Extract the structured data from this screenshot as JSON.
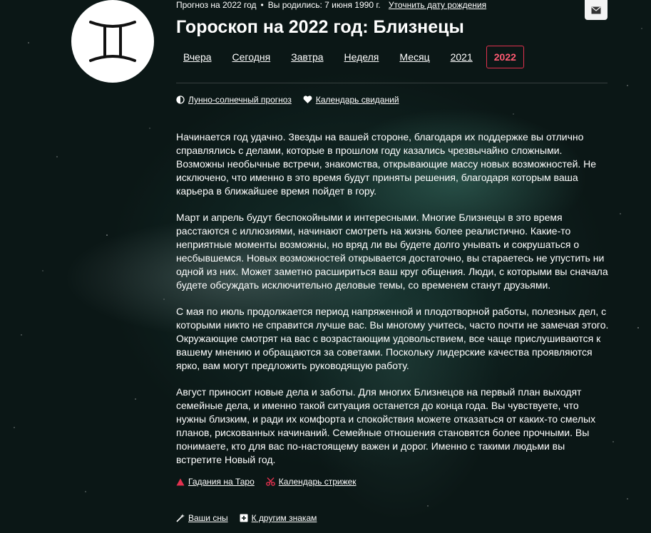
{
  "header": {
    "forecast_year_text": "Прогноз на 2022 год",
    "birth_text": "Вы родились: 7 июня 1990 г.",
    "change_birth_link": "Уточнить дату рождения",
    "title": "Гороскоп на 2022 год: Близнецы"
  },
  "tabs": [
    {
      "label": "Вчера",
      "active": false
    },
    {
      "label": "Сегодня",
      "active": false
    },
    {
      "label": "Завтра",
      "active": false
    },
    {
      "label": "Неделя",
      "active": false
    },
    {
      "label": "Месяц",
      "active": false
    },
    {
      "label": "2021",
      "active": false
    },
    {
      "label": "2022",
      "active": true
    }
  ],
  "top_links": [
    {
      "label": "Лунно-солнечный прогноз",
      "icon": "moon-half-icon"
    },
    {
      "label": "Календарь свиданий",
      "icon": "heart-icon"
    }
  ],
  "paragraphs": [
    "Начинается год удачно. Звезды на вашей стороне, благодаря их поддержке вы отлично справлялись с делами, которые в прошлом году казались чрезвычайно сложными. Возможны необычные встречи, знакомства, открывающие массу новых возможностей. Не исключено, что именно в это время будут приняты решения, благодаря которым ваша карьера в ближайшее время пойдет в гору.",
    "Март и апрель будут беспокойными и интересными. Многие Близнецы в это время расстаются с иллюзиями, начинают смотреть на жизнь более реалистично. Какие-то неприятные моменты возможны, но вряд ли вы будете долго унывать и сокрушаться о несбывшемся. Новых возможностей открывается достаточно, вы стараетесь не упустить ни одной из них. Может заметно расшириться ваш круг общения. Люди, с которыми вы сначала будете обсуждать исключительно деловые темы, со временем станут друзьями.",
    "С мая по июль продолжается период напряженной и плодотворной работы, полезных дел, с которыми никто не справится лучше вас. Вы многому учитесь, часто почти не замечая этого. Окружающие смотрят на вас с возрастающим удовольствием, все чаще прислушиваются к вашему мнению и обращаются за советами. Поскольку лидерские качества проявляются ярко, вам могут предложить руководящую работу.",
    "Август приносит новые дела и заботы. Для многих Близнецов на первый план выходят семейные дела, и именно такой ситуация останется до конца года. Вы чувствуете, что нужны близким, и ради их комфорта и спокойствия можете отказаться от каких-то смелых планов, рискованных начинаний. Семейные отношения становятся более прочными. Вы понимаете, кто для вас по-настоящему важен и дорог. Именно с такими людьми вы встретите Новый год."
  ],
  "bottom_links_1": [
    {
      "label": "Гадания на Таро",
      "icon": "triangle-icon",
      "color": "#e3314f"
    },
    {
      "label": "Календарь стрижек",
      "icon": "scissors-icon",
      "color": "#e3314f"
    }
  ],
  "bottom_links_2": [
    {
      "label": "Ваши сны",
      "icon": "magic-wand-icon"
    },
    {
      "label": "К другим знакам",
      "icon": "plus-box-icon"
    }
  ],
  "colors": {
    "accent": "#e3314f",
    "background": "#0b1716"
  }
}
